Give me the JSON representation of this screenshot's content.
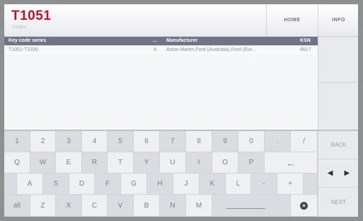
{
  "header": {
    "title": "T1051",
    "subtitle": "Codes",
    "home_label": "HOME",
    "info_label": "INFO"
  },
  "table": {
    "columns": [
      "Key code series",
      "...",
      "Manufacturer",
      "KSN"
    ],
    "rows": [
      [
        "T1051-T2330",
        "6",
        "Aston Martin,Ford (Australia),Ford (Eur...",
        "4617"
      ]
    ]
  },
  "keyboard": {
    "row1": [
      "1",
      "2",
      "3",
      "4",
      "5",
      "6",
      "7",
      "8",
      "9",
      "0",
      ".",
      "/"
    ],
    "row2": [
      "Q",
      "W",
      "E",
      "R",
      "T",
      "Y",
      "U",
      "I",
      "O",
      "P",
      "←"
    ],
    "row3": [
      "A",
      "S",
      "D",
      "F",
      "G",
      "H",
      "J",
      "K",
      "L",
      "-",
      "+"
    ],
    "row4": [
      "alt",
      "Z",
      "X",
      "C",
      "V",
      "B",
      "N",
      "M",
      "",
      ""
    ]
  },
  "nav": {
    "back_label": "BACK",
    "left_arrow": "◀",
    "right_arrow": "▶",
    "next_label": "NEXT"
  },
  "icons": {
    "clear": "×"
  }
}
